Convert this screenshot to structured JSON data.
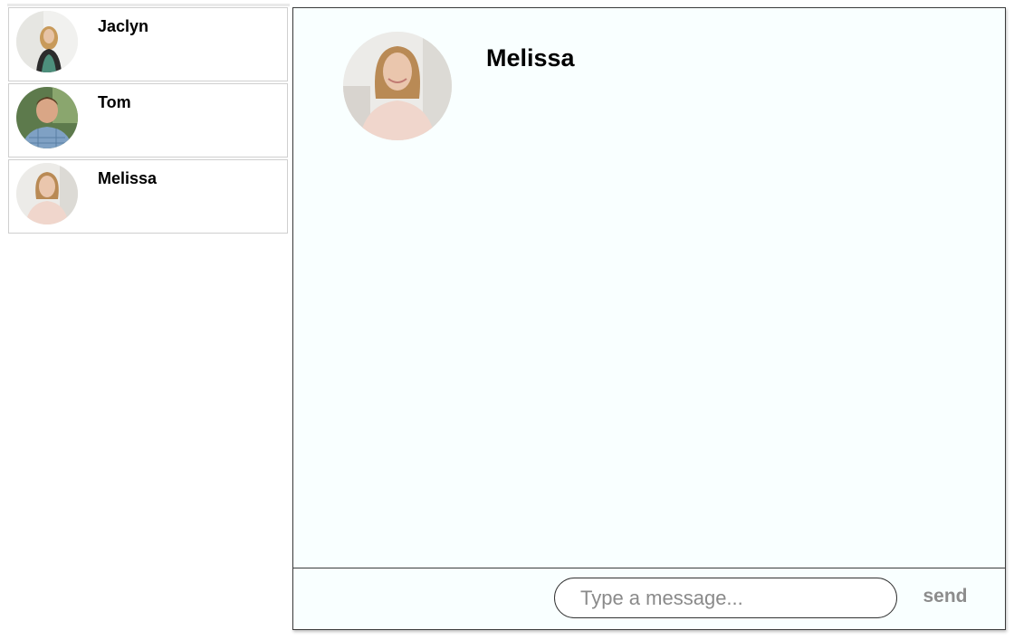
{
  "contacts": [
    {
      "name": "Jaclyn",
      "avatar_icon": "person-avatar-woman-blonde"
    },
    {
      "name": "Tom",
      "avatar_icon": "person-avatar-man-plaid-shirt"
    },
    {
      "name": "Melissa",
      "avatar_icon": "person-avatar-woman-pink-top"
    }
  ],
  "chat": {
    "contact_name": "Melissa",
    "avatar_icon": "person-avatar-woman-pink-top",
    "messages": []
  },
  "composer": {
    "placeholder": "Type a message...",
    "value": "",
    "send_label": "send"
  },
  "colors": {
    "chat_background": "#f9ffff",
    "border": "#3b3b3b",
    "send_text": "#8c8c8c"
  }
}
